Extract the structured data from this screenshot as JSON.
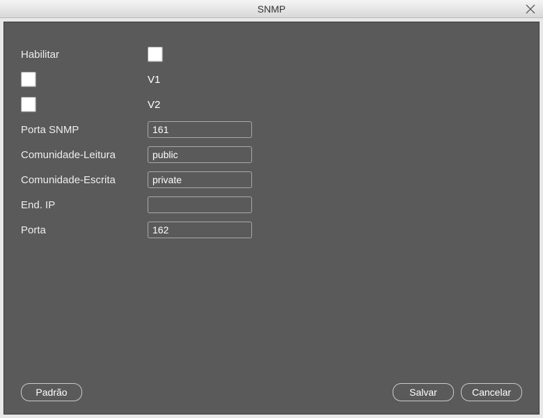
{
  "window": {
    "title": "SNMP"
  },
  "form": {
    "habilitar_label": "Habilitar",
    "v1_label": "V1",
    "v2_label": "V2",
    "porta_snmp_label": "Porta SNMP",
    "porta_snmp_value": "161",
    "comunidade_leitura_label": "Comunidade-Leitura",
    "comunidade_leitura_value": "public",
    "comunidade_escrita_label": "Comunidade-Escrita",
    "comunidade_escrita_value": "private",
    "end_ip_label": "End. IP",
    "end_ip_value": "",
    "porta_label": "Porta",
    "porta_value": "162"
  },
  "buttons": {
    "padrao": "Padrão",
    "salvar": "Salvar",
    "cancelar": "Cancelar"
  }
}
